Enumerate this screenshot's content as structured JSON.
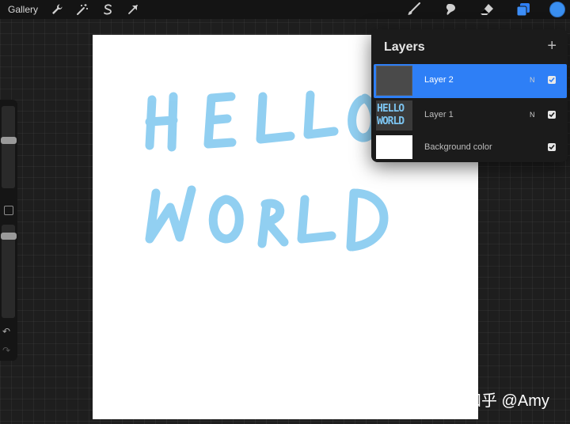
{
  "toolbar": {
    "gallery_label": "Gallery",
    "left_icons": [
      "wrench-icon",
      "magic-wand-icon",
      "selection-icon",
      "transform-arrow-icon"
    ],
    "right_icons": [
      "brush-icon",
      "smudge-icon",
      "eraser-icon",
      "layers-icon"
    ],
    "active_color": "#3a8ff0"
  },
  "canvas": {
    "drawing_text_line1": "HELLO",
    "drawing_text_line2": "WORLD",
    "stroke_color": "#8ccdf1"
  },
  "layers_panel": {
    "title": "Layers",
    "add_icon": "plus-icon",
    "layers": [
      {
        "name": "Layer 2",
        "blend": "N",
        "visible": true,
        "selected": true
      },
      {
        "name": "Layer 1",
        "blend": "N",
        "visible": true,
        "selected": false,
        "thumb_line1": "HELLO",
        "thumb_line2": "WORLD"
      },
      {
        "name": "Background color",
        "visible": true,
        "selected": false
      }
    ]
  },
  "watermark": "知乎 @Amy",
  "accent_color": "#2e7ff6"
}
